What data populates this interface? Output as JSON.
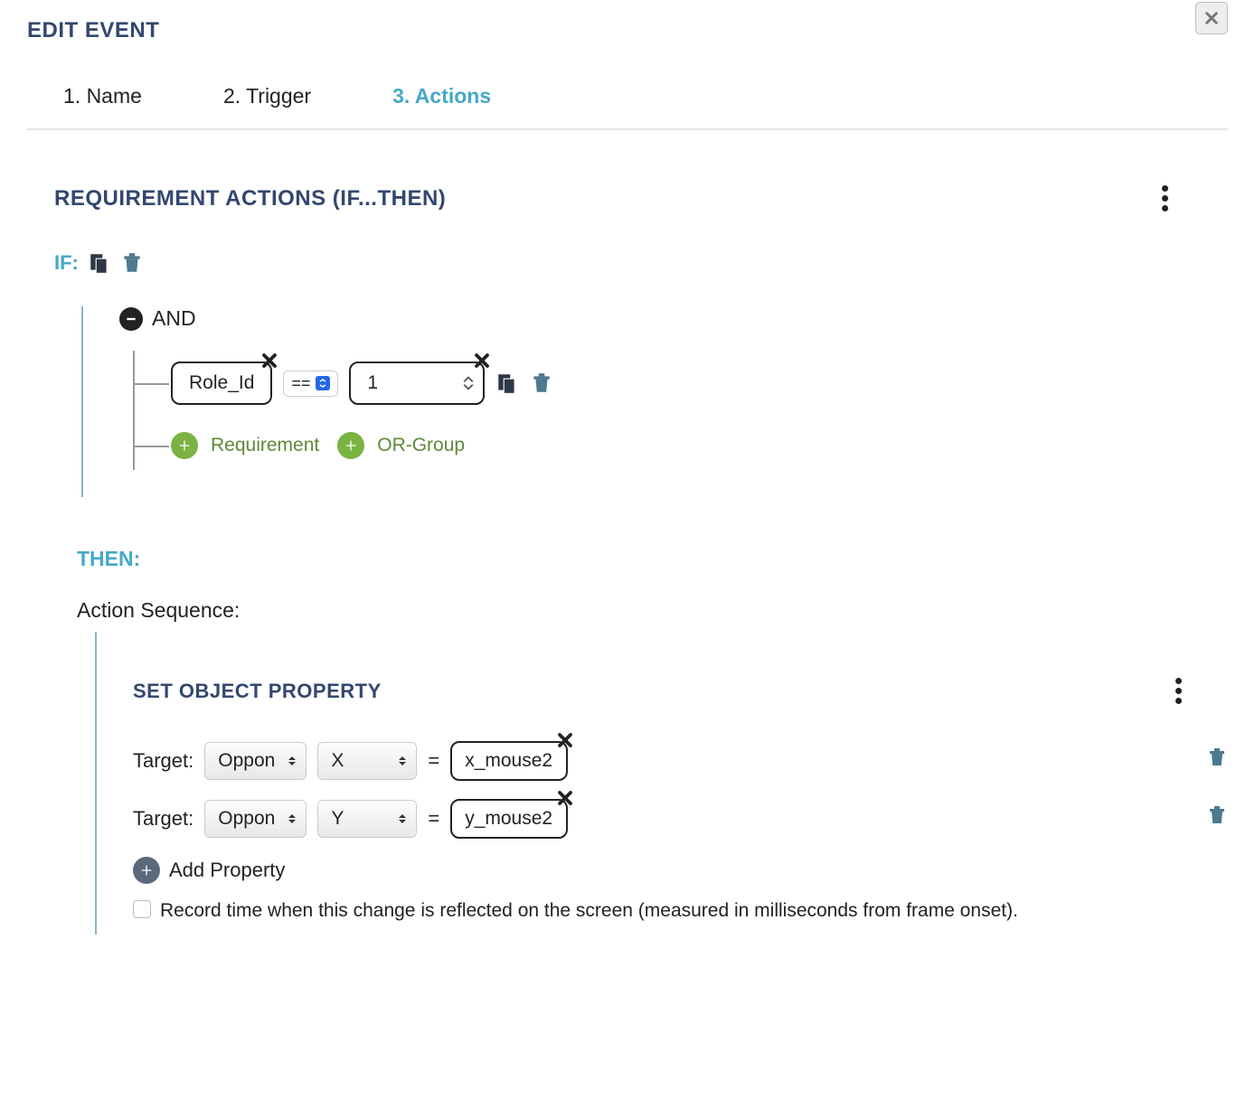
{
  "header": {
    "title": "EDIT EVENT"
  },
  "tabs": [
    {
      "label": "1. Name",
      "active": false
    },
    {
      "label": "2. Trigger",
      "active": false
    },
    {
      "label": "3. Actions",
      "active": true
    }
  ],
  "requirements": {
    "title": "REQUIREMENT ACTIONS (IF...THEN)",
    "if_label": "IF:",
    "logic_op": "AND",
    "conditions": [
      {
        "field": "Role_Id",
        "operator": "==",
        "value": "1"
      }
    ],
    "add_requirement_label": "Requirement",
    "add_orgroup_label": "OR-Group"
  },
  "then": {
    "label": "THEN:",
    "sequence_label": "Action Sequence:"
  },
  "set_object": {
    "title": "SET OBJECT PROPERTY",
    "target_label": "Target:",
    "rows": [
      {
        "target": "Oppon",
        "property": "X",
        "value": "x_mouse2"
      },
      {
        "target": "Oppon",
        "property": "Y",
        "value": "y_mouse2"
      }
    ],
    "add_property_label": "Add Property",
    "record_time_label": "Record time when this change is reflected on the screen (measured in milliseconds from frame onset)."
  }
}
